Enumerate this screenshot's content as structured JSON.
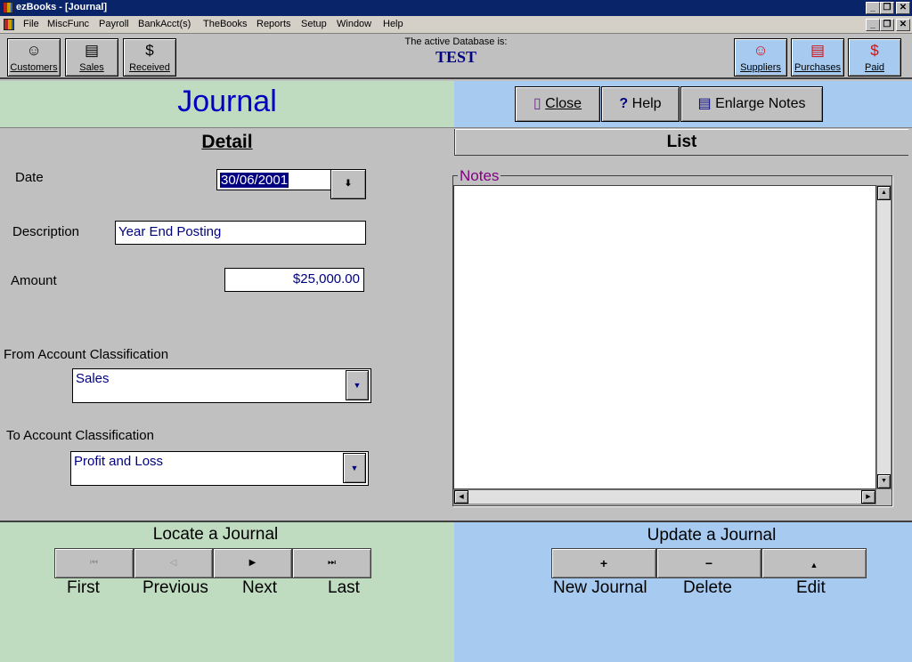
{
  "window": {
    "title": "ezBooks - [Journal]"
  },
  "menu": [
    "File",
    "MiscFunc",
    "Payroll",
    "BankAcct(s)",
    "TheBooks",
    "Reports",
    "Setup",
    "Window",
    "Help"
  ],
  "toolbar": {
    "left": [
      {
        "label": "Customers",
        "icon": "☺"
      },
      {
        "label": "Sales",
        "icon": "▤"
      },
      {
        "label": "Received",
        "icon": "$"
      }
    ],
    "right": [
      {
        "label": "Suppliers",
        "icon": "☺"
      },
      {
        "label": "Purchases",
        "icon": "▤"
      },
      {
        "label": "Paid",
        "icon": "$"
      }
    ],
    "db_caption": "The active Database is:",
    "db_name": "TEST"
  },
  "form": {
    "title": "Journal",
    "close_label": "Close",
    "help_label": "Help",
    "enlarge_notes_label": "Enlarge Notes",
    "tab_detail": "Detail",
    "tab_list": "List",
    "date_label": "Date",
    "date_value": "30/06/2001",
    "description_label": "Description",
    "description_value": "Year End Posting",
    "amount_label": "Amount",
    "amount_value": "$25,000.00",
    "from_label": "From Account Classification",
    "from_value": "Sales",
    "to_label": "To Account Classification",
    "to_value": "Profit and Loss",
    "notes_label": "Notes",
    "notes_value": ""
  },
  "locate": {
    "title": "Locate a Journal",
    "first": "First",
    "previous": "Previous",
    "next": "Next",
    "last": "Last"
  },
  "update": {
    "title": "Update a Journal",
    "new": "New Journal",
    "delete": "Delete",
    "edit": "Edit"
  },
  "colors": {
    "accent_title": "#0000c0",
    "notes_label": "#800080",
    "field_text": "#000080"
  }
}
